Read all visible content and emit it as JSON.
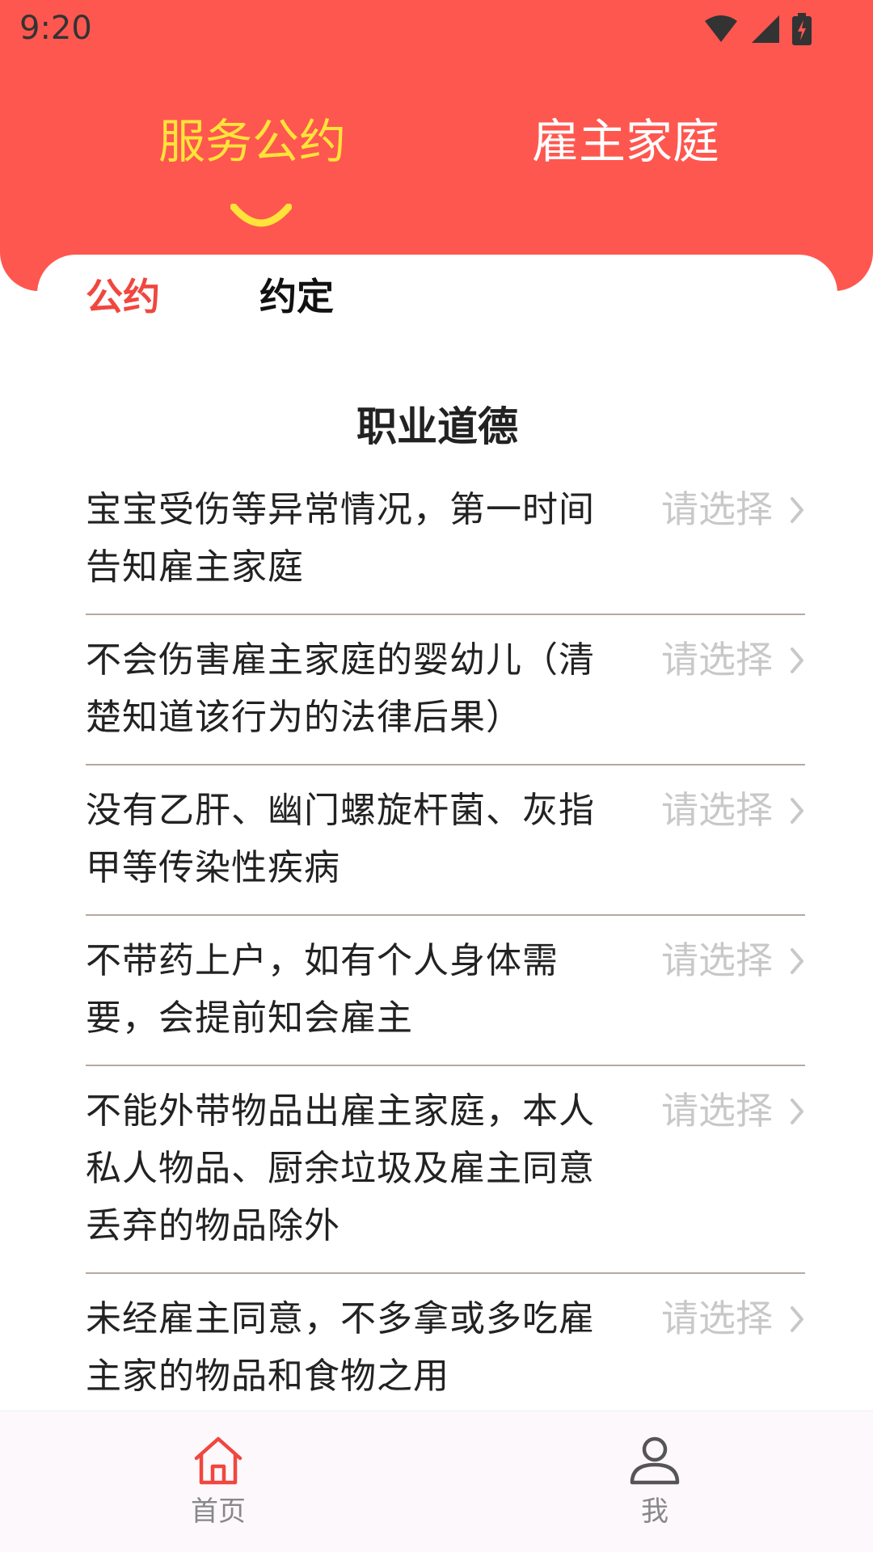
{
  "status_bar": {
    "time": "9:20",
    "icons": [
      "wifi-icon",
      "cellular-signal-icon",
      "battery-charging-icon"
    ]
  },
  "top_tabs": [
    {
      "label": "服务公约",
      "active": true
    },
    {
      "label": "雇主家庭",
      "active": false
    }
  ],
  "sub_tabs": [
    {
      "label": "公约",
      "active": true
    },
    {
      "label": "约定",
      "active": false
    }
  ],
  "section": {
    "title": "职业道德"
  },
  "items": [
    {
      "text": "宝宝受伤等异常情况，第一时间告知雇主家庭",
      "select_label": "请选择"
    },
    {
      "text": "不会伤害雇主家庭的婴幼儿（清楚知道该行为的法律后果）",
      "select_label": "请选择"
    },
    {
      "text": "没有乙肝、幽门螺旋杆菌、灰指甲等传染性疾病",
      "select_label": "请选择"
    },
    {
      "text": "不带药上户，如有个人身体需要，会提前知会雇主",
      "select_label": "请选择"
    },
    {
      "text": "不能外带物品出雇主家庭，本人私人物品、厨余垃圾及雇主同意丢弃的物品除外",
      "select_label": "请选择"
    },
    {
      "text": "未经雇主同意，不多拿或多吃雇主家的物品和食物之用",
      "select_label": "请选择"
    }
  ],
  "bottom_nav": [
    {
      "label": "首页",
      "icon": "home-icon"
    },
    {
      "label": "我",
      "icon": "user-icon"
    }
  ],
  "colors": {
    "header_red": "#FE574F",
    "active_tab_yellow": "#FFE33A",
    "sub_tab_active_red": "#F0473F",
    "placeholder_gray": "#C8C8C8",
    "divider": "#B8A89E"
  }
}
